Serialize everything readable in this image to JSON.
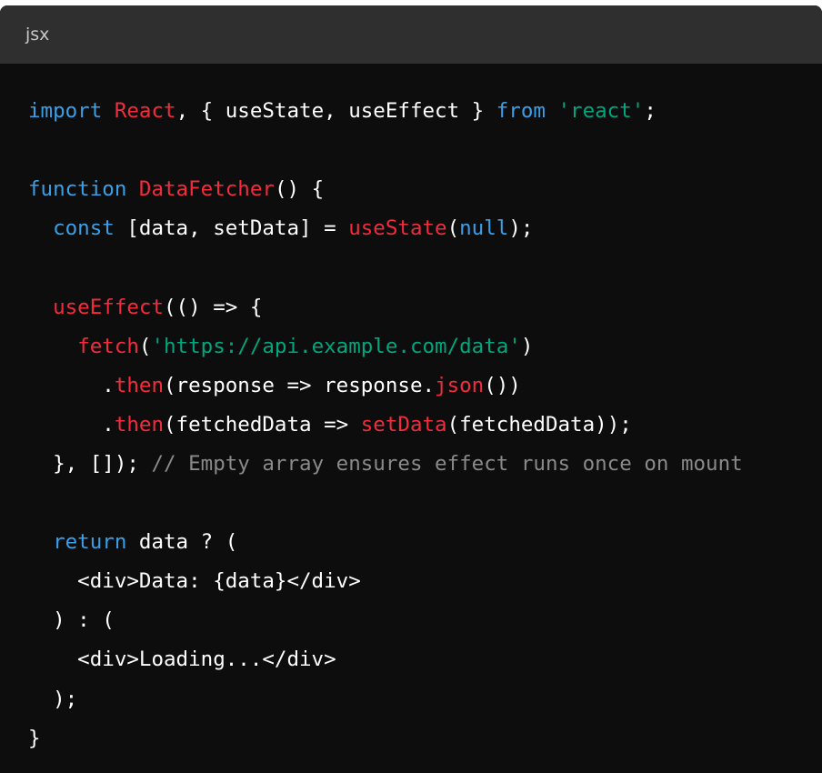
{
  "header": {
    "language": "jsx"
  },
  "colors": {
    "background": "#0d0d0d",
    "header_background": "#2f2f2f",
    "keyword": "#3b9fe8",
    "name": "#f22c3d",
    "string": "#00a67d",
    "comment": "#8a8a8a",
    "plain": "#ffffff"
  },
  "code": {
    "lines": [
      [
        {
          "t": "keyword",
          "v": "import"
        },
        {
          "t": "plain",
          "v": " "
        },
        {
          "t": "name",
          "v": "React"
        },
        {
          "t": "plain",
          "v": ", { useState, useEffect } "
        },
        {
          "t": "keyword",
          "v": "from"
        },
        {
          "t": "plain",
          "v": " "
        },
        {
          "t": "string",
          "v": "'react'"
        },
        {
          "t": "plain",
          "v": ";"
        }
      ],
      [],
      [
        {
          "t": "keyword",
          "v": "function"
        },
        {
          "t": "plain",
          "v": " "
        },
        {
          "t": "name",
          "v": "DataFetcher"
        },
        {
          "t": "plain",
          "v": "() {"
        }
      ],
      [
        {
          "t": "plain",
          "v": "  "
        },
        {
          "t": "keyword",
          "v": "const"
        },
        {
          "t": "plain",
          "v": " [data, setData] = "
        },
        {
          "t": "name",
          "v": "useState"
        },
        {
          "t": "plain",
          "v": "("
        },
        {
          "t": "keyword",
          "v": "null"
        },
        {
          "t": "plain",
          "v": ");"
        }
      ],
      [],
      [
        {
          "t": "plain",
          "v": "  "
        },
        {
          "t": "name",
          "v": "useEffect"
        },
        {
          "t": "plain",
          "v": "(() => {"
        }
      ],
      [
        {
          "t": "plain",
          "v": "    "
        },
        {
          "t": "name",
          "v": "fetch"
        },
        {
          "t": "plain",
          "v": "("
        },
        {
          "t": "string",
          "v": "'https://api.example.com/data'"
        },
        {
          "t": "plain",
          "v": ")"
        }
      ],
      [
        {
          "t": "plain",
          "v": "      ."
        },
        {
          "t": "name",
          "v": "then"
        },
        {
          "t": "plain",
          "v": "(response => response."
        },
        {
          "t": "name",
          "v": "json"
        },
        {
          "t": "plain",
          "v": "())"
        }
      ],
      [
        {
          "t": "plain",
          "v": "      ."
        },
        {
          "t": "name",
          "v": "then"
        },
        {
          "t": "plain",
          "v": "(fetchedData => "
        },
        {
          "t": "name",
          "v": "setData"
        },
        {
          "t": "plain",
          "v": "(fetchedData));"
        }
      ],
      [
        {
          "t": "plain",
          "v": "  }, []); "
        },
        {
          "t": "comment",
          "v": "// Empty array ensures effect runs once on mount"
        }
      ],
      [],
      [
        {
          "t": "plain",
          "v": "  "
        },
        {
          "t": "keyword",
          "v": "return"
        },
        {
          "t": "plain",
          "v": " data ? ("
        }
      ],
      [
        {
          "t": "plain",
          "v": "    <div>Data: {data}</div>"
        }
      ],
      [
        {
          "t": "plain",
          "v": "  ) : ("
        }
      ],
      [
        {
          "t": "plain",
          "v": "    <div>Loading...</div>"
        }
      ],
      [
        {
          "t": "plain",
          "v": "  );"
        }
      ],
      [
        {
          "t": "plain",
          "v": "}"
        }
      ]
    ]
  }
}
